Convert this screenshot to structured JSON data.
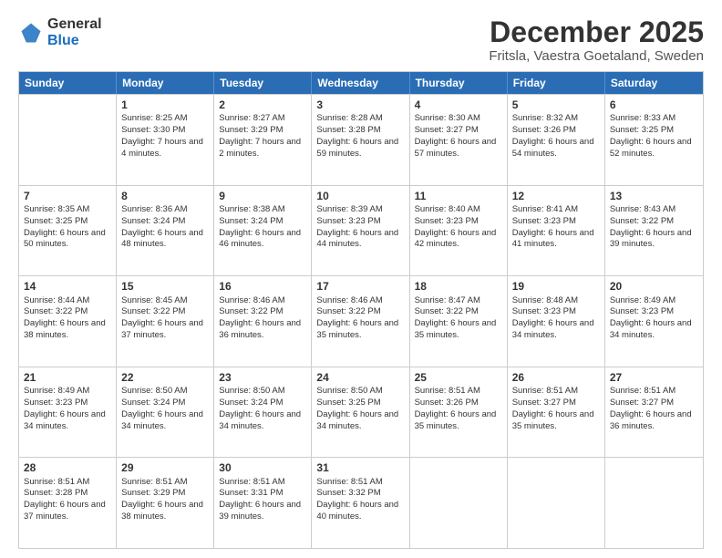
{
  "logo": {
    "general": "General",
    "blue": "Blue"
  },
  "title": "December 2025",
  "subtitle": "Fritsla, Vaestra Goetaland, Sweden",
  "header_days": [
    "Sunday",
    "Monday",
    "Tuesday",
    "Wednesday",
    "Thursday",
    "Friday",
    "Saturday"
  ],
  "weeks": [
    [
      {
        "day": "",
        "sunrise": "",
        "sunset": "",
        "daylight": ""
      },
      {
        "day": "1",
        "sunrise": "Sunrise: 8:25 AM",
        "sunset": "Sunset: 3:30 PM",
        "daylight": "Daylight: 7 hours and 4 minutes."
      },
      {
        "day": "2",
        "sunrise": "Sunrise: 8:27 AM",
        "sunset": "Sunset: 3:29 PM",
        "daylight": "Daylight: 7 hours and 2 minutes."
      },
      {
        "day": "3",
        "sunrise": "Sunrise: 8:28 AM",
        "sunset": "Sunset: 3:28 PM",
        "daylight": "Daylight: 6 hours and 59 minutes."
      },
      {
        "day": "4",
        "sunrise": "Sunrise: 8:30 AM",
        "sunset": "Sunset: 3:27 PM",
        "daylight": "Daylight: 6 hours and 57 minutes."
      },
      {
        "day": "5",
        "sunrise": "Sunrise: 8:32 AM",
        "sunset": "Sunset: 3:26 PM",
        "daylight": "Daylight: 6 hours and 54 minutes."
      },
      {
        "day": "6",
        "sunrise": "Sunrise: 8:33 AM",
        "sunset": "Sunset: 3:25 PM",
        "daylight": "Daylight: 6 hours and 52 minutes."
      }
    ],
    [
      {
        "day": "7",
        "sunrise": "Sunrise: 8:35 AM",
        "sunset": "Sunset: 3:25 PM",
        "daylight": "Daylight: 6 hours and 50 minutes."
      },
      {
        "day": "8",
        "sunrise": "Sunrise: 8:36 AM",
        "sunset": "Sunset: 3:24 PM",
        "daylight": "Daylight: 6 hours and 48 minutes."
      },
      {
        "day": "9",
        "sunrise": "Sunrise: 8:38 AM",
        "sunset": "Sunset: 3:24 PM",
        "daylight": "Daylight: 6 hours and 46 minutes."
      },
      {
        "day": "10",
        "sunrise": "Sunrise: 8:39 AM",
        "sunset": "Sunset: 3:23 PM",
        "daylight": "Daylight: 6 hours and 44 minutes."
      },
      {
        "day": "11",
        "sunrise": "Sunrise: 8:40 AM",
        "sunset": "Sunset: 3:23 PM",
        "daylight": "Daylight: 6 hours and 42 minutes."
      },
      {
        "day": "12",
        "sunrise": "Sunrise: 8:41 AM",
        "sunset": "Sunset: 3:23 PM",
        "daylight": "Daylight: 6 hours and 41 minutes."
      },
      {
        "day": "13",
        "sunrise": "Sunrise: 8:43 AM",
        "sunset": "Sunset: 3:22 PM",
        "daylight": "Daylight: 6 hours and 39 minutes."
      }
    ],
    [
      {
        "day": "14",
        "sunrise": "Sunrise: 8:44 AM",
        "sunset": "Sunset: 3:22 PM",
        "daylight": "Daylight: 6 hours and 38 minutes."
      },
      {
        "day": "15",
        "sunrise": "Sunrise: 8:45 AM",
        "sunset": "Sunset: 3:22 PM",
        "daylight": "Daylight: 6 hours and 37 minutes."
      },
      {
        "day": "16",
        "sunrise": "Sunrise: 8:46 AM",
        "sunset": "Sunset: 3:22 PM",
        "daylight": "Daylight: 6 hours and 36 minutes."
      },
      {
        "day": "17",
        "sunrise": "Sunrise: 8:46 AM",
        "sunset": "Sunset: 3:22 PM",
        "daylight": "Daylight: 6 hours and 35 minutes."
      },
      {
        "day": "18",
        "sunrise": "Sunrise: 8:47 AM",
        "sunset": "Sunset: 3:22 PM",
        "daylight": "Daylight: 6 hours and 35 minutes."
      },
      {
        "day": "19",
        "sunrise": "Sunrise: 8:48 AM",
        "sunset": "Sunset: 3:23 PM",
        "daylight": "Daylight: 6 hours and 34 minutes."
      },
      {
        "day": "20",
        "sunrise": "Sunrise: 8:49 AM",
        "sunset": "Sunset: 3:23 PM",
        "daylight": "Daylight: 6 hours and 34 minutes."
      }
    ],
    [
      {
        "day": "21",
        "sunrise": "Sunrise: 8:49 AM",
        "sunset": "Sunset: 3:23 PM",
        "daylight": "Daylight: 6 hours and 34 minutes."
      },
      {
        "day": "22",
        "sunrise": "Sunrise: 8:50 AM",
        "sunset": "Sunset: 3:24 PM",
        "daylight": "Daylight: 6 hours and 34 minutes."
      },
      {
        "day": "23",
        "sunrise": "Sunrise: 8:50 AM",
        "sunset": "Sunset: 3:24 PM",
        "daylight": "Daylight: 6 hours and 34 minutes."
      },
      {
        "day": "24",
        "sunrise": "Sunrise: 8:50 AM",
        "sunset": "Sunset: 3:25 PM",
        "daylight": "Daylight: 6 hours and 34 minutes."
      },
      {
        "day": "25",
        "sunrise": "Sunrise: 8:51 AM",
        "sunset": "Sunset: 3:26 PM",
        "daylight": "Daylight: 6 hours and 35 minutes."
      },
      {
        "day": "26",
        "sunrise": "Sunrise: 8:51 AM",
        "sunset": "Sunset: 3:27 PM",
        "daylight": "Daylight: 6 hours and 35 minutes."
      },
      {
        "day": "27",
        "sunrise": "Sunrise: 8:51 AM",
        "sunset": "Sunset: 3:27 PM",
        "daylight": "Daylight: 6 hours and 36 minutes."
      }
    ],
    [
      {
        "day": "28",
        "sunrise": "Sunrise: 8:51 AM",
        "sunset": "Sunset: 3:28 PM",
        "daylight": "Daylight: 6 hours and 37 minutes."
      },
      {
        "day": "29",
        "sunrise": "Sunrise: 8:51 AM",
        "sunset": "Sunset: 3:29 PM",
        "daylight": "Daylight: 6 hours and 38 minutes."
      },
      {
        "day": "30",
        "sunrise": "Sunrise: 8:51 AM",
        "sunset": "Sunset: 3:31 PM",
        "daylight": "Daylight: 6 hours and 39 minutes."
      },
      {
        "day": "31",
        "sunrise": "Sunrise: 8:51 AM",
        "sunset": "Sunset: 3:32 PM",
        "daylight": "Daylight: 6 hours and 40 minutes."
      },
      {
        "day": "",
        "sunrise": "",
        "sunset": "",
        "daylight": ""
      },
      {
        "day": "",
        "sunrise": "",
        "sunset": "",
        "daylight": ""
      },
      {
        "day": "",
        "sunrise": "",
        "sunset": "",
        "daylight": ""
      }
    ]
  ]
}
